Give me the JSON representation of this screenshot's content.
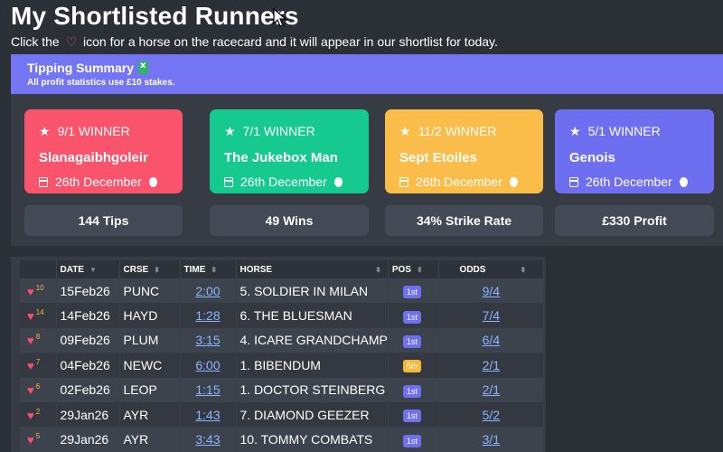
{
  "page": {
    "title": "My Shortlisted Runners",
    "subtitle_before": "Click the",
    "subtitle_after": "icon for a horse on the racecard and it will appear in our shortlist for today."
  },
  "summary": {
    "title": "Tipping Summary",
    "note": "All profit statistics use £10 stakes.",
    "cards": [
      {
        "odds_label": "9/1 WINNER",
        "horse": "Slanagaibhgoleir",
        "date": "26th December",
        "color": "#f9546b"
      },
      {
        "odds_label": "7/1 WINNER",
        "horse": "The Jukebox Man",
        "date": "26th December",
        "color": "#15c98f"
      },
      {
        "odds_label": "11/2 WINNER",
        "horse": "Sept Etoiles",
        "date": "26th December",
        "color": "#fbbd4a"
      },
      {
        "odds_label": "5/1 WINNER",
        "horse": "Genois",
        "date": "26th December",
        "color": "#6e6ff0"
      }
    ],
    "stats": {
      "tips": "144 Tips",
      "wins": "49 Wins",
      "strike_rate": "34% Strike Rate",
      "profit": "£330 Profit"
    }
  },
  "table": {
    "headers": {
      "date": "DATE",
      "course": "CRSE",
      "time": "TIME",
      "horse": "HORSE",
      "pos": "POS",
      "odds": "ODDS"
    },
    "rows": [
      {
        "count": "10",
        "date": "15Feb26",
        "course": "PUNC",
        "time": "2:00",
        "horse": "5. SOLDIER IN MILAN",
        "pos": "1st",
        "odds": "9/4"
      },
      {
        "count": "14",
        "date": "14Feb26",
        "course": "HAYD",
        "time": "1:28",
        "horse": "6. THE BLUESMAN",
        "pos": "1st",
        "odds": "7/4"
      },
      {
        "count": "8",
        "date": "09Feb26",
        "course": "PLUM",
        "time": "3:15",
        "horse": "4. ICARE GRANDCHAMP",
        "pos": "1st",
        "odds": "6/4"
      },
      {
        "count": "7",
        "date": "04Feb26",
        "course": "NEWC",
        "time": "6:00",
        "horse": "1. BIBENDUM",
        "pos": "5th",
        "odds": "2/1"
      },
      {
        "count": "6",
        "date": "02Feb26",
        "course": "LEOP",
        "time": "1:15",
        "horse": "1. DOCTOR STEINBERG",
        "pos": "1st",
        "odds": "2/1"
      },
      {
        "count": "2",
        "date": "29Jan26",
        "course": "AYR",
        "time": "1:43",
        "horse": "7. DIAMOND GEEZER",
        "pos": "1st",
        "odds": "5/2"
      },
      {
        "count": "5",
        "date": "29Jan26",
        "course": "AYR",
        "time": "3:43",
        "horse": "10. TOMMY COMBATS",
        "pos": "1st",
        "odds": "3/1"
      }
    ]
  }
}
